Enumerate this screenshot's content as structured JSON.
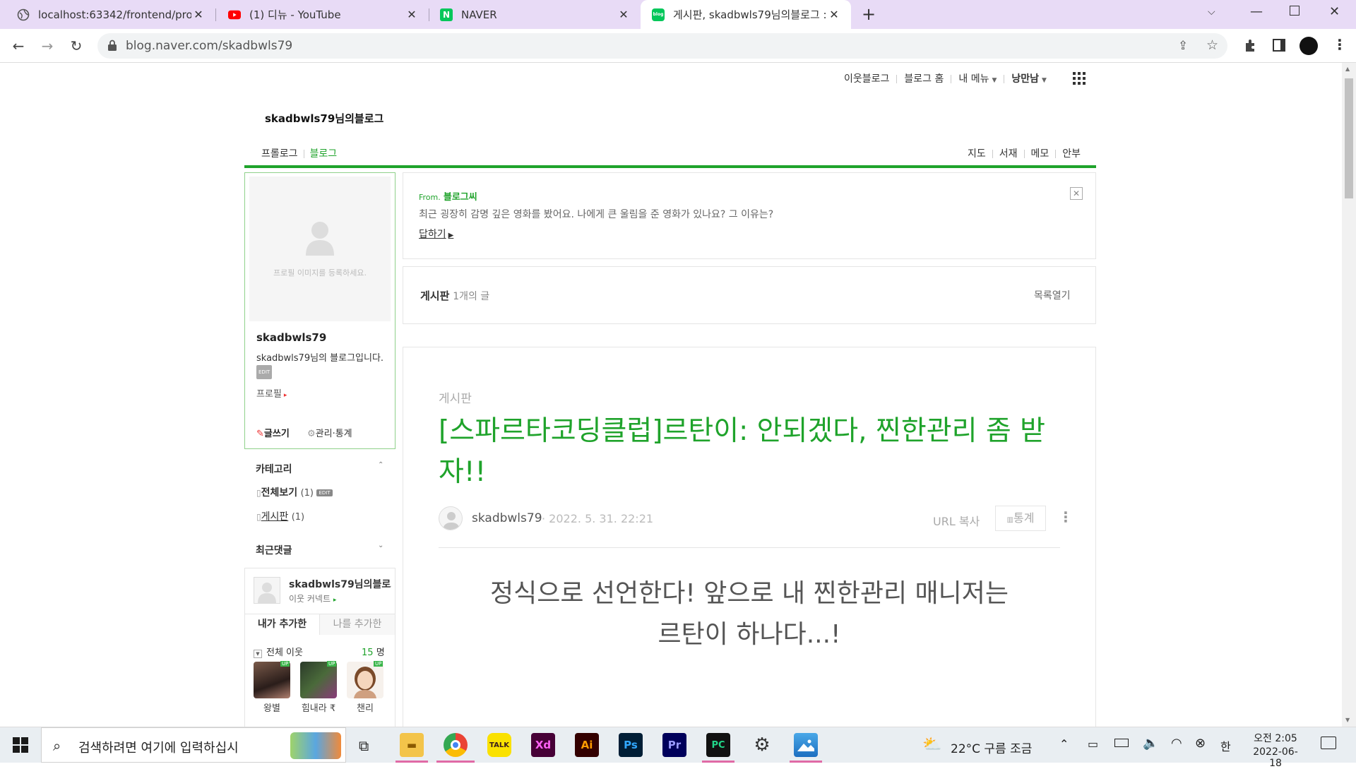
{
  "browser": {
    "tabs": [
      {
        "title": "localhost:63342/frontend/profile"
      },
      {
        "title": "(1) 디뉴 - YouTube"
      },
      {
        "title": "NAVER"
      },
      {
        "title": "게시판, skadbwls79님의블로그 :"
      }
    ],
    "url": "blog.naver.com/skadbwls79"
  },
  "gnb": {
    "neighbor_blog": "이웃블로그",
    "blog_home": "블로그 홈",
    "my_menu": "내 메뉴",
    "user": "낭만남"
  },
  "blog": {
    "title": "skadbwls79님의블로그",
    "menu_prologue": "프롤로그",
    "menu_blog": "블로그",
    "right_menu": [
      "지도",
      "서재",
      "메모",
      "안부"
    ]
  },
  "profile": {
    "image_placeholder": "프로필 이미지를 등록하세요.",
    "nickname": "skadbwls79",
    "intro": "skadbwls79님의 블로그입니다.",
    "edit_badge": "EDIT",
    "profile_link": "프로필",
    "write": "글쓰기",
    "manage": "관리·통계"
  },
  "category": {
    "title": "카테고리",
    "items": [
      {
        "label": "전체보기",
        "count": "(1)"
      },
      {
        "label": "게시판",
        "count": "(1)"
      }
    ]
  },
  "recent_comments": {
    "title": "최근댓글"
  },
  "neighbors": {
    "blog_name": "skadbwls79님의블로그",
    "connect": "이웃 커넥트",
    "tab_mine": "내가 추가한",
    "tab_others": "나를 추가한",
    "all_label": "전체 이웃",
    "count": "15",
    "unit": "명",
    "people": [
      {
        "name": "왕별",
        "badge": "UP"
      },
      {
        "name": "힘내라 ₹",
        "badge": "UP"
      },
      {
        "name": "챈리",
        "badge": "UP"
      }
    ]
  },
  "notice": {
    "from_label": "From.",
    "from_name": "블로그씨",
    "question": "최근 굉장히 감명 깊은 영화를 봤어요. 나에게 큰 울림을 준 영화가 있나요? 그 이유는?",
    "reply": "답하기"
  },
  "board": {
    "name": "게시판",
    "count": "1개의 글",
    "toggle": "목록열기"
  },
  "post": {
    "category": "게시판",
    "title": "[스파르타코딩클럽]르탄이: 안되겠다, 찐한관리 좀 받자!!",
    "author": "skadbwls79",
    "date": "· 2022. 5. 31. 22:21",
    "url_copy": "URL 복사",
    "stats": "통계",
    "body_line1": "정식으로 선언한다! 앞으로 내 찐한관리 매니저는",
    "body_line2": "르탄이 하나다...!"
  },
  "taskbar": {
    "search_placeholder": "검색하려면 여기에 입력하십시",
    "weather": "22°C  구름 조금",
    "ime": "한",
    "time": "오전 2:05",
    "date": "2022-06-18",
    "apps": [
      "explorer",
      "chrome",
      "kakaotalk",
      "xd",
      "illustrator",
      "photoshop",
      "premiere",
      "pycharm",
      "settings",
      "photos"
    ]
  },
  "colors": {
    "accent": "#1fa32b",
    "tabbar": "#e8dbf6"
  }
}
